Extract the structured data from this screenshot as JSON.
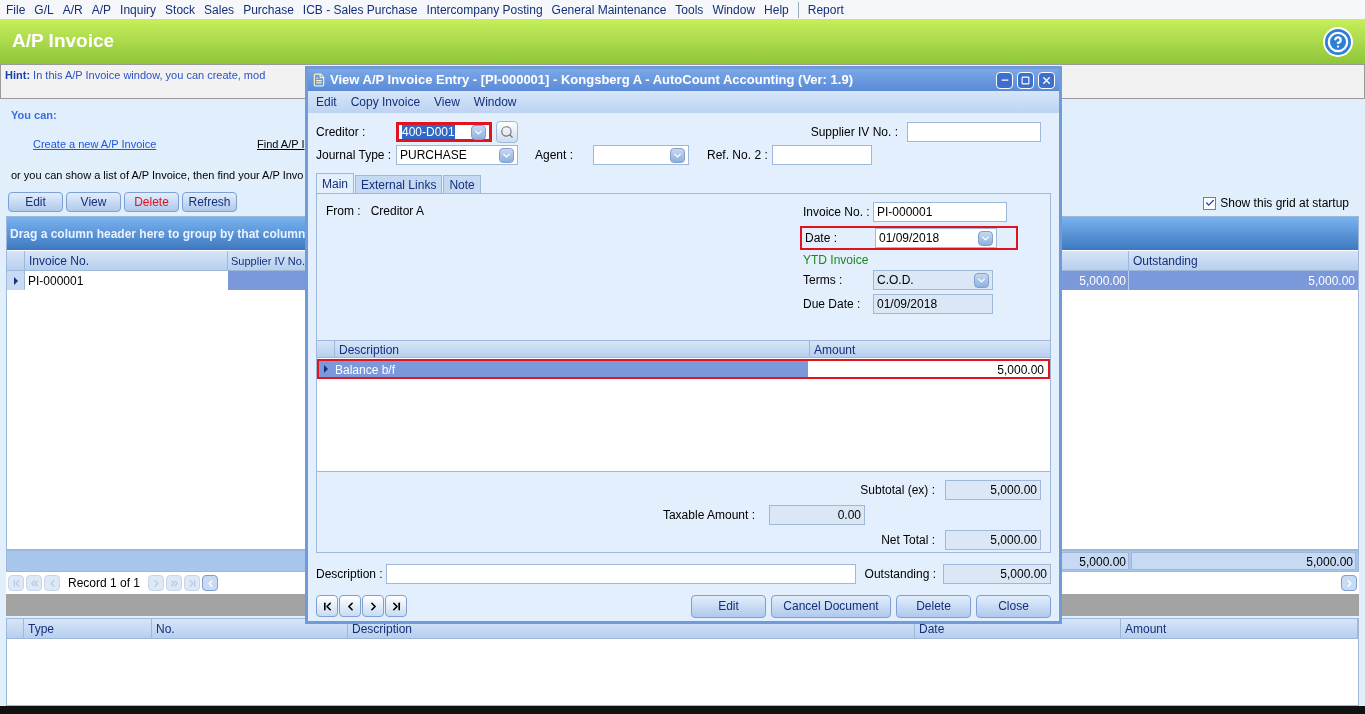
{
  "menu_bar": [
    "File",
    "G/L",
    "A/R",
    "A/P",
    "Inquiry",
    "Stock",
    "Sales",
    "Purchase",
    "ICB - Sales Purchase",
    "Intercompany Posting",
    "General Maintenance",
    "Tools",
    "Window",
    "Help"
  ],
  "extra_menu": [
    "Report"
  ],
  "page_title": "A/P Invoice",
  "hint": {
    "label": "Hint:",
    "text": "In this A/P Invoice window, you can create, mod"
  },
  "you_can": {
    "heading": "You can:",
    "create_link": "Create a new A/P Invoice",
    "find_link": "Find A/P I",
    "list_text": "or you can show a list of A/P Invoice, then find your A/P Invo"
  },
  "toolbar": [
    {
      "label": "Edit",
      "kind": "normal"
    },
    {
      "label": "View",
      "kind": "normal"
    },
    {
      "label": "Delete",
      "kind": "danger"
    },
    {
      "label": "Refresh",
      "kind": "normal"
    }
  ],
  "show_grid": {
    "label": "Show this grid at startup",
    "checked": true
  },
  "invoice_grid": {
    "group_hint": "Drag a column header here to group by that column",
    "columns": [
      "Invoice No.",
      "Supplier IV No.",
      "Outstanding"
    ],
    "rows": [
      {
        "selected": true,
        "invoice_no": "PI-000001",
        "column_3": "5,000.00",
        "outstanding": "5,000.00"
      }
    ],
    "footer": [
      "5,000.00",
      "5,000.00"
    ]
  },
  "record_nav": {
    "text": "Record 1 of 1"
  },
  "detail_grid": {
    "columns": [
      "Type",
      "No.",
      "Description",
      "Date",
      "Amount"
    ]
  },
  "dialog": {
    "title": "View A/P Invoice Entry - [PI-000001] - Kongsberg A - AutoCount Accounting (Ver: 1.9)",
    "menu": [
      "Edit",
      "Copy Invoice",
      "View",
      "Window"
    ],
    "creditor": {
      "label": "Creditor :",
      "value": "400-D001",
      "highlighted": true
    },
    "supplier_iv": {
      "label": "Supplier IV No. :"
    },
    "journal_type": {
      "label": "Journal Type :",
      "value": "PURCHASE"
    },
    "agent": {
      "label": "Agent :"
    },
    "ref_no_2": {
      "label": "Ref. No. 2 :"
    },
    "tabs": [
      {
        "label": "Main",
        "selected": true
      },
      {
        "label": "External Links",
        "selected": false
      },
      {
        "label": "Note",
        "selected": false
      }
    ],
    "from": {
      "label": "From :",
      "value": "Creditor A"
    },
    "invoice_no": {
      "label": "Invoice No. :",
      "value": "PI-000001"
    },
    "date": {
      "label": "Date :",
      "value": "01/09/2018",
      "highlighted": true
    },
    "ytd": "YTD Invoice",
    "terms": {
      "label": "Terms :",
      "value": "C.O.D."
    },
    "due_date": {
      "label": "Due Date :",
      "value": "01/09/2018"
    },
    "lines": {
      "columns": [
        "Description",
        "Amount"
      ],
      "rows": [
        {
          "description": "Balance b/f",
          "amount": "5,000.00",
          "selected": true,
          "highlighted": true
        }
      ]
    },
    "subtotal": {
      "label": "Subtotal (ex) :",
      "value": "5,000.00"
    },
    "taxable": {
      "label": "Taxable Amount :",
      "value": "0.00"
    },
    "net_total": {
      "label": "Net Total :",
      "value": "5,000.00"
    },
    "description": {
      "label": "Description :"
    },
    "outstanding": {
      "label": "Outstanding :",
      "value": "5,000.00"
    },
    "buttons": [
      "Edit",
      "Cancel Document",
      "Delete",
      "Close"
    ]
  }
}
